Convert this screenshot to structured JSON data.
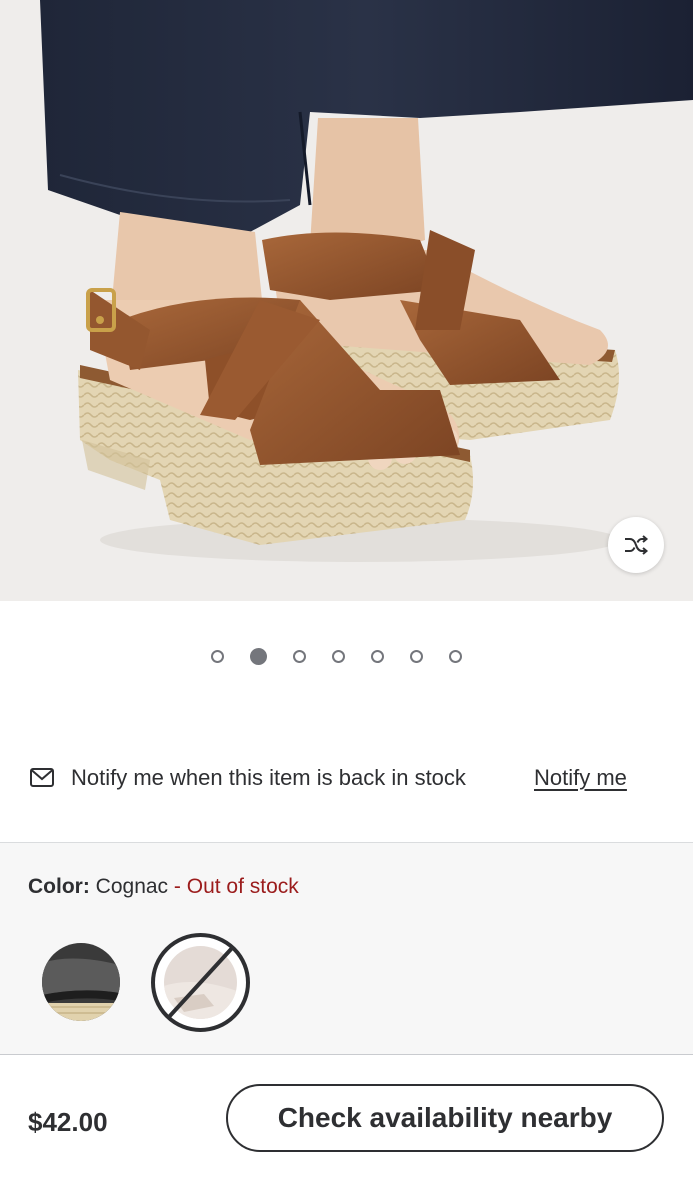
{
  "product_image": {
    "description_icon": "shuffle-icon",
    "carousel": {
      "total": 7,
      "active_index": 1
    }
  },
  "notify": {
    "icon": "mail-icon",
    "message": "Notify me when this item is back in stock",
    "link_label": "Notify me"
  },
  "color": {
    "label": "Color:",
    "selected": "Cognac",
    "status": "- Out of stock",
    "status_color": "#9b1c1c",
    "swatches": [
      {
        "name": "Black",
        "available": true,
        "selected": false
      },
      {
        "name": "Cognac",
        "available": false,
        "selected": true
      }
    ]
  },
  "footer": {
    "price": "$42.00",
    "cta_label": "Check availability nearby"
  }
}
